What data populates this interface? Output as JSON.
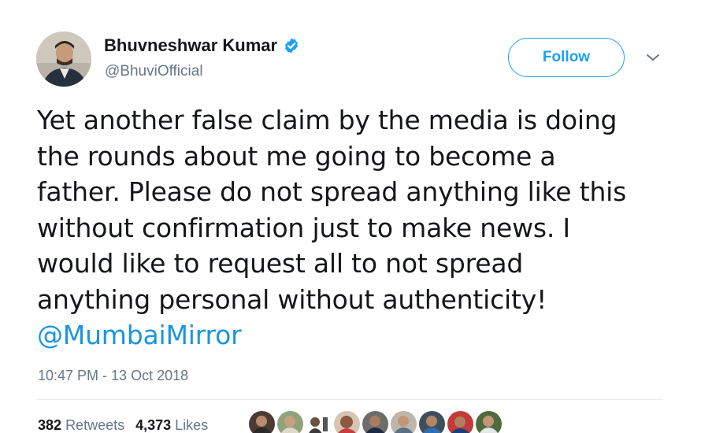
{
  "author": {
    "name": "Bhuvneshwar Kumar",
    "handle": "@BhuviOfficial",
    "verified": true,
    "avatar_icon": "profile-photo"
  },
  "follow_button": {
    "label": "Follow"
  },
  "menu": {
    "icon": "chevron-down-icon"
  },
  "tweet": {
    "lines": [
      "Yet another false claim by the media is doing",
      "the rounds about me going to become a",
      "father. Please do not spread anything like this",
      "without confirmation just to make news. I",
      "would like to request all to not spread",
      "anything personal without authenticity!"
    ],
    "mention": "@MumbaiMirror",
    "timestamp": "10:47 PM - 13 Oct 2018"
  },
  "stats": {
    "retweets_count": "382",
    "retweets_label": "Retweets",
    "likes_count": "4,373",
    "likes_label": "Likes"
  },
  "colors": {
    "accent": "#1da1f2",
    "mention": "#1b95e0",
    "secondary_text": "#657786",
    "primary_text": "#14171a"
  },
  "liked_by_avatars": [
    "avatar",
    "avatar",
    "avatar",
    "avatar",
    "avatar",
    "avatar",
    "avatar",
    "avatar",
    "avatar"
  ]
}
